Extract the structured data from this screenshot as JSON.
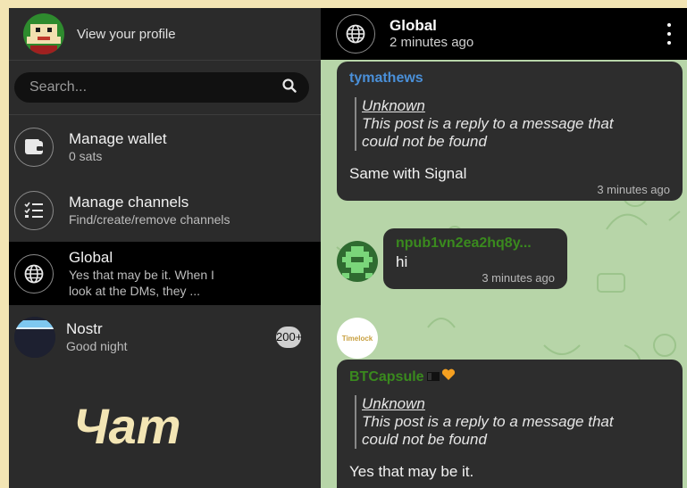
{
  "sidebar": {
    "profile_label": "View your profile",
    "search_placeholder": "Search...",
    "items": [
      {
        "title": "Manage wallet",
        "subtitle": "0 sats",
        "icon": "wallet-icon"
      },
      {
        "title": "Manage channels",
        "subtitle": "Find/create/remove channels",
        "icon": "checklist-icon"
      },
      {
        "title": "Global",
        "subtitle_line1": "Yes that may be it. When I",
        "subtitle_line2": "look at the DMs, they ...",
        "icon": "globe-icon",
        "active": true
      },
      {
        "title": "Nostr",
        "subtitle": "Good night",
        "badge": "200+"
      }
    ],
    "watermark": "Чат"
  },
  "chat": {
    "title": "Global",
    "subtitle": "2 minutes ago",
    "messages": [
      {
        "sender": "tymathews",
        "sender_color": "#4a90d9",
        "quote_author": "Unknown",
        "quote_line1": "This post is a reply to a message that",
        "quote_line2": "could not be found",
        "text": "Same with Signal",
        "time": "3 minutes ago"
      },
      {
        "sender": "npub1vn2ea2hq8y...",
        "sender_color": "#3a8a1e",
        "text": "hi",
        "time": "3 minutes ago"
      },
      {
        "sender": "BTCapsule",
        "sender_color": "#3a8a1e",
        "avatar_text": "Timelock",
        "quote_author": "Unknown",
        "quote_line1": "This post is a reply to a message that",
        "quote_line2": "could not be found",
        "text": "Yes that may be it."
      }
    ]
  },
  "colors": {
    "accent_blue": "#4a90d9",
    "accent_green": "#3a8a1e",
    "badge_bg": "#cfcfcf",
    "chat_bg": "#b7d5a8"
  }
}
